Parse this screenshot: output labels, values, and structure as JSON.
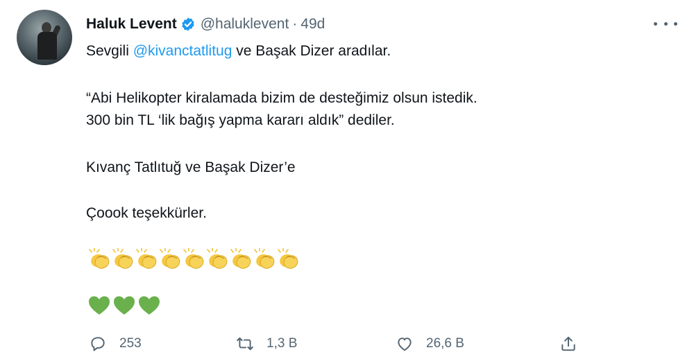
{
  "author": {
    "name": "Haluk Levent",
    "handle": "@haluklevent",
    "separator": "·",
    "time": "49d",
    "avatar": "avatar-photo"
  },
  "tweet": {
    "line1_prefix": "Sevgili ",
    "mention": "@kivanctatlitug",
    "line1_suffix": " ve Başak Dizer aradılar.",
    "line2": "“Abi Helikopter kiralamada bizim de desteğimiz olsun istedik.",
    "line3": "300 bin TL ‘lik bağış yapma kararı aldık” dediler.",
    "line4": "Kıvanç Tatlıtuğ ve Başak Dizer’e",
    "line5": "Çoook teşekkürler.",
    "emoji_clap_count": 9,
    "emoji_heart_count": 3,
    "clap_color": "#f5c842",
    "heart_color": "#6ab04c"
  },
  "actions": {
    "reply_count": "253",
    "retweet_count": "1,3 B",
    "like_count": "26,6 B",
    "icons": [
      "reply-icon",
      "retweet-icon",
      "like-icon",
      "share-icon"
    ]
  },
  "colors": {
    "accent": "#1d9bf0",
    "secondary_text": "#536471",
    "primary_text": "#0f1419"
  }
}
